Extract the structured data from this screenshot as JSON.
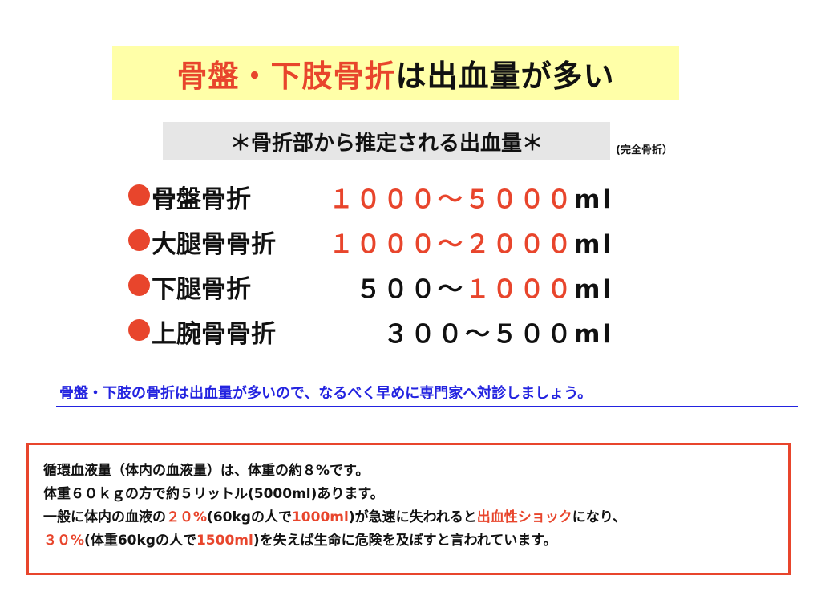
{
  "title": {
    "red_part": "骨盤・下肢骨折",
    "black_part": "は出血量が多い",
    "background": "#ffffa8"
  },
  "subtitle": {
    "text": "＊骨折部から推定される出血量＊",
    "note": "(完全骨折）",
    "background": "#e6e6e6"
  },
  "fractures": [
    {
      "label": "骨盤骨折",
      "value_red": "１０００〜５０００",
      "value_black": "",
      "unit": "ml"
    },
    {
      "label": "大腿骨骨折",
      "value_red": "１０００〜２０００",
      "value_black": "",
      "unit": "ml"
    },
    {
      "label": "下腿骨折",
      "value_black": "５００〜",
      "value_red": "１０００",
      "unit": "ml"
    },
    {
      "label": "上腕骨骨折",
      "value_black": "３００〜５００",
      "value_red": "",
      "unit": "ml"
    }
  ],
  "advice": "骨盤・下肢の骨折は出血量が多いので、なるべく早めに専門家へ対診しましょう。",
  "info": {
    "line1": "循環血液量（体内の血液量）は、体重の約８%です。",
    "line2": "体重６０ｋｇの方で約５リットル(5000ml)あります。",
    "line3": {
      "a": "一般に体内の血液の",
      "b": "２０%",
      "c": "(60kgの人で",
      "d": "1000ml",
      "e": ")が急速に失われると",
      "f": "出血性ショック",
      "g": "になり、"
    },
    "line4": {
      "a": "３０%",
      "b": "(体重60kgの人で",
      "c": "1500ml",
      "d": ")を失えば生命に危険を及ぼすと言われています。"
    }
  },
  "colors": {
    "accent_red": "#e8452c",
    "link_blue": "#2323e0",
    "text": "#111111"
  }
}
